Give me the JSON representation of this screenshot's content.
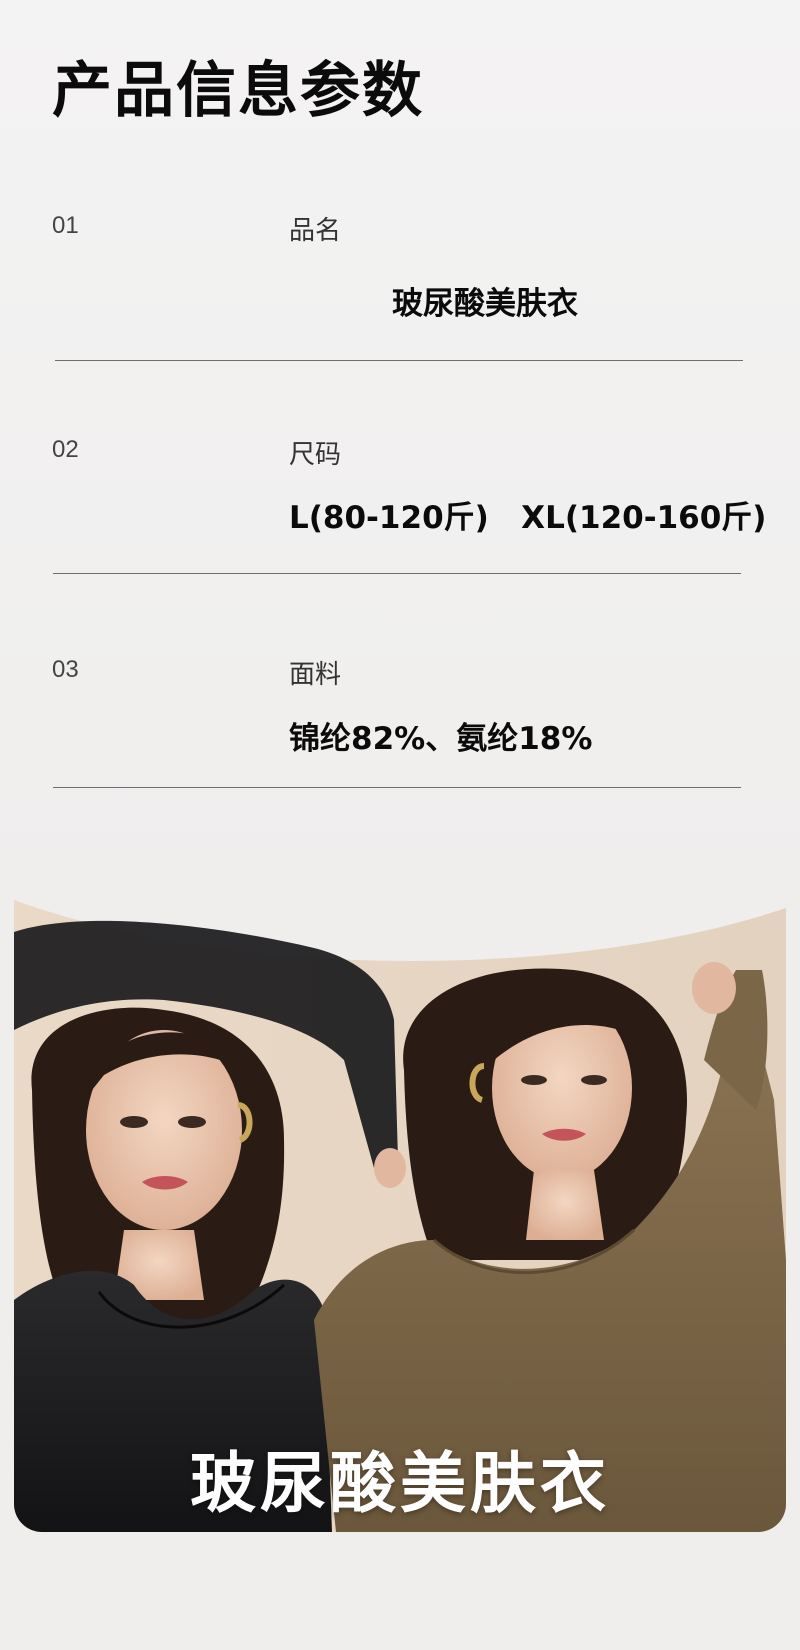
{
  "header": {
    "title": "产品信息参数"
  },
  "specs": [
    {
      "number": "01",
      "label": "品名",
      "value": "玻尿酸美肤衣"
    },
    {
      "number": "02",
      "label": "尺码",
      "value": "L(80-120斤)   XL(120-160斤)"
    },
    {
      "number": "03",
      "label": "面料",
      "value": "锦纶82%、氨纶18%"
    }
  ],
  "banner": {
    "caption": "玻尿酸美肤衣"
  },
  "colors": {
    "page_background": "#efeeed",
    "divider": "#6e6e6e",
    "panel_background": "#e7d8c9",
    "garment_black": "#1a1a1c",
    "garment_brown": "#7b6648",
    "hair": "#2a1b15",
    "skin": "#ecc9b3"
  }
}
